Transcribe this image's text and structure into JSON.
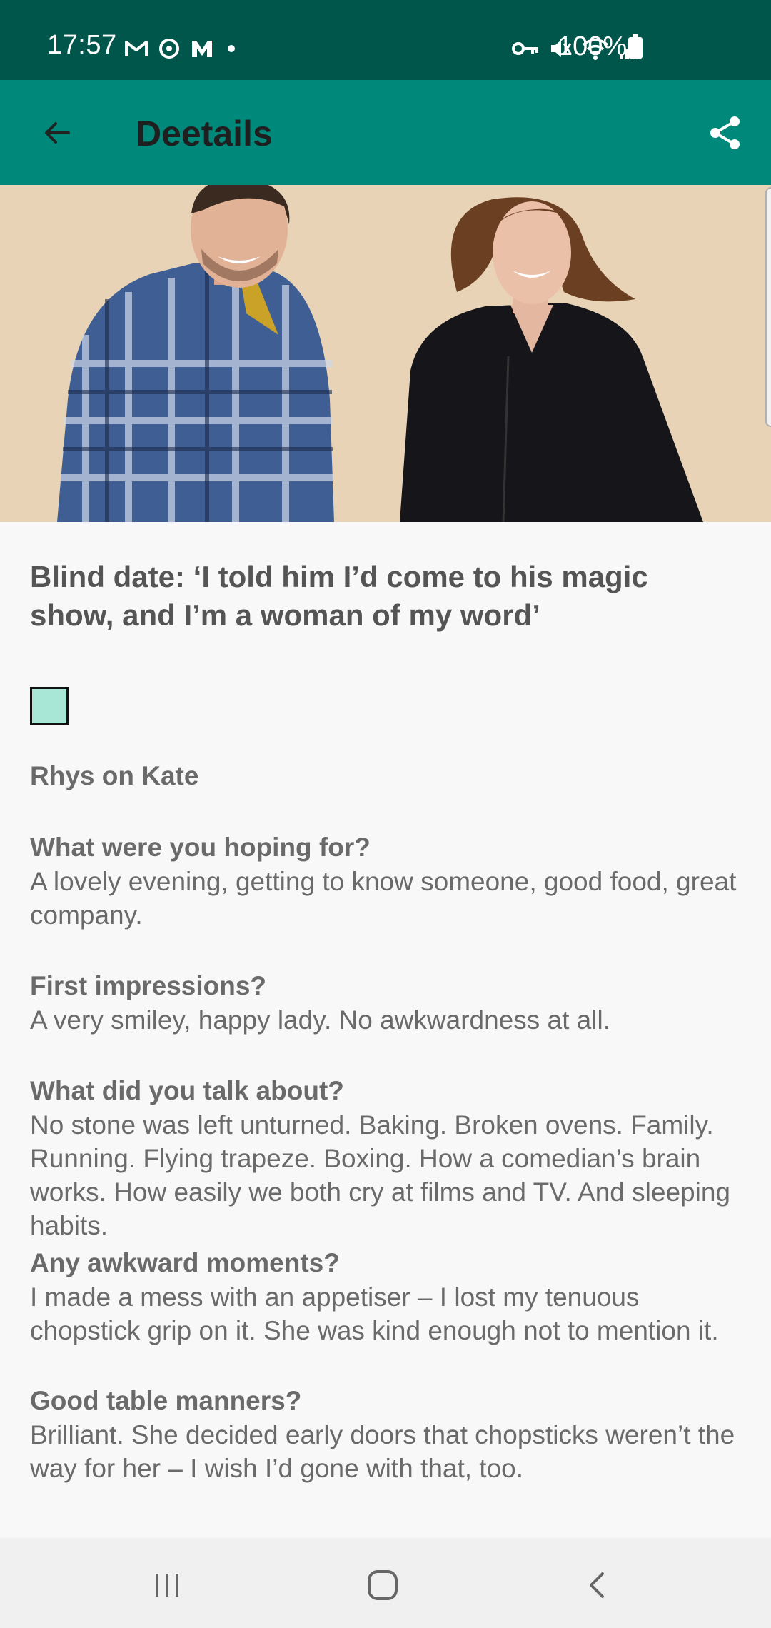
{
  "status": {
    "time": "17:57",
    "battery": "100%",
    "left_icons": [
      "gmail-icon",
      "sync-icon",
      "m-icon",
      "dot-icon"
    ],
    "right_icons": [
      "vpn-key-icon",
      "mute-icon",
      "wifi-icon",
      "signal-icon"
    ]
  },
  "app_bar": {
    "title": "Deetails",
    "back_icon": "arrow-left-icon",
    "share_icon": "share-icon"
  },
  "colors": {
    "status_bar": "#00564a",
    "app_bar": "#00897b",
    "hero_bg": "#e8d3b7",
    "placeholder": "#a8e6d6"
  },
  "article": {
    "headline": "Blind date: ‘I told him I’d come to his magic show, and I’m a woman of my word’",
    "section": "Rhys on Kate",
    "qa": [
      {
        "q": "What were you hoping for?",
        "a": "A lovely evening, getting to know someone, good food, great company."
      },
      {
        "q": "First impressions?",
        "a": "A very smiley, happy lady. No awkwardness at all."
      },
      {
        "q": "What did you talk about?",
        "a": "No stone was left unturned. Baking. Broken ovens. Family. Running. Flying trapeze. Boxing. How a comedian’s brain works. How easily we both cry at films and TV. And sleeping habits."
      },
      {
        "q": "Any awkward moments?",
        "a": "I made a mess with an appetiser – I lost my tenuous chopstick grip on it. She was kind enough not to mention it."
      },
      {
        "q": "Good table manners?",
        "a": "Brilliant. She decided early doors that chopsticks weren’t the way for her – I wish I’d gone with that, too."
      }
    ]
  },
  "nav": {
    "icons": [
      "recents-icon",
      "home-icon",
      "back-icon"
    ]
  }
}
